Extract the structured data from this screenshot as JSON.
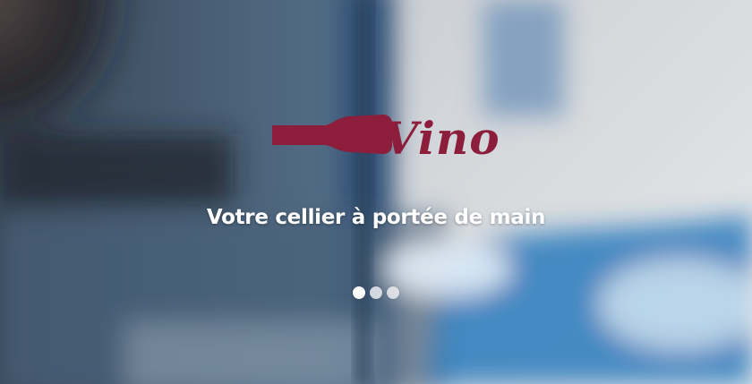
{
  "brand": {
    "name": "Vino",
    "color": "#8c1e3c"
  },
  "hero": {
    "tagline": "Votre cellier à portée de main"
  },
  "carousel": {
    "slide_count": 3,
    "active_index": 0
  }
}
